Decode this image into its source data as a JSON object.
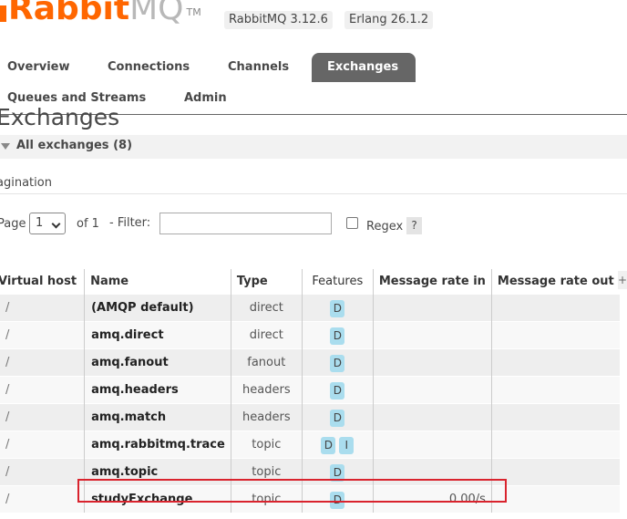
{
  "header": {
    "logo_rabbit": "Rabbit",
    "logo_mq": "MQ",
    "logo_tm": "TM",
    "rabbitmq_version": "RabbitMQ 3.12.6",
    "erlang_version": "Erlang 26.1.2"
  },
  "nav": {
    "tabs": [
      {
        "label": "Overview"
      },
      {
        "label": "Connections"
      },
      {
        "label": "Channels"
      },
      {
        "label": "Exchanges",
        "active": true
      },
      {
        "label": "Queues and Streams"
      },
      {
        "label": "Admin"
      }
    ]
  },
  "page": {
    "title": "Exchanges",
    "section_label": "All exchanges (8)",
    "pagination_label": "agination"
  },
  "pagination": {
    "page_label": "Page",
    "page_value": "1",
    "of_label": "of 1",
    "filter_label": "- Filter:",
    "filter_value": "",
    "regex_label": "Regex",
    "help_label": "?"
  },
  "table": {
    "headers": {
      "vhost": "Virtual host",
      "name": "Name",
      "type": "Type",
      "features": "Features",
      "rate_in": "Message rate in",
      "rate_out": "Message rate out",
      "toggle": "+/-"
    },
    "rows": [
      {
        "vhost": "/",
        "name": "(AMQP default)",
        "type": "direct",
        "features": [
          "D"
        ],
        "rate_in": "",
        "rate_out": ""
      },
      {
        "vhost": "/",
        "name": "amq.direct",
        "type": "direct",
        "features": [
          "D"
        ],
        "rate_in": "",
        "rate_out": ""
      },
      {
        "vhost": "/",
        "name": "amq.fanout",
        "type": "fanout",
        "features": [
          "D"
        ],
        "rate_in": "",
        "rate_out": ""
      },
      {
        "vhost": "/",
        "name": "amq.headers",
        "type": "headers",
        "features": [
          "D"
        ],
        "rate_in": "",
        "rate_out": ""
      },
      {
        "vhost": "/",
        "name": "amq.match",
        "type": "headers",
        "features": [
          "D"
        ],
        "rate_in": "",
        "rate_out": ""
      },
      {
        "vhost": "/",
        "name": "amq.rabbitmq.trace",
        "type": "topic",
        "features": [
          "D",
          "I"
        ],
        "rate_in": "",
        "rate_out": ""
      },
      {
        "vhost": "/",
        "name": "amq.topic",
        "type": "topic",
        "features": [
          "D"
        ],
        "rate_in": "",
        "rate_out": ""
      },
      {
        "vhost": "/",
        "name": "studyExchange",
        "type": "topic",
        "features": [
          "D"
        ],
        "rate_in": "0.00/s",
        "rate_out": ""
      }
    ]
  },
  "colors": {
    "brand_orange": "#ff6600",
    "active_tab": "#666666",
    "feature_tag": "#aaddee",
    "highlight": "#d9232d"
  }
}
